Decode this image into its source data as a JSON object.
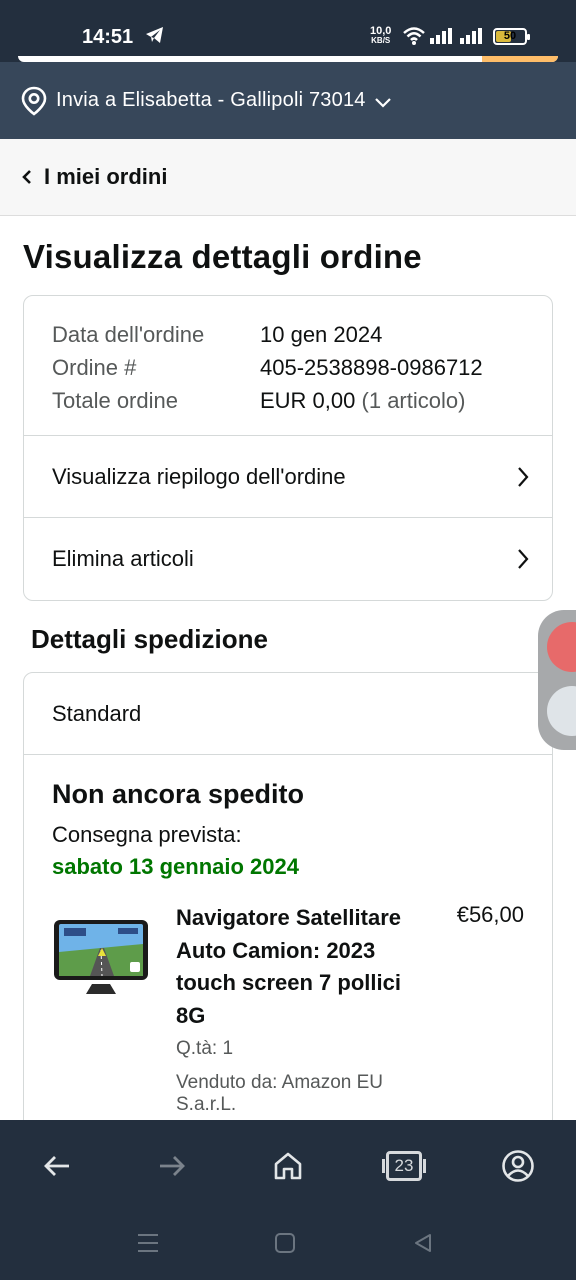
{
  "status_bar": {
    "time": "14:51",
    "net_speed_value": "10,0",
    "net_speed_unit": "KB/S",
    "battery": "50",
    "battery_level": 0.5
  },
  "deliver": {
    "text": "Invia a Elisabetta - Gallipoli 73014"
  },
  "nav": {
    "back_label": "I miei ordini"
  },
  "page": {
    "title": "Visualizza dettagli ordine"
  },
  "order": {
    "date_label": "Data dell'ordine",
    "date_value": "10 gen 2024",
    "number_label": "Ordine #",
    "number_value": "405-2538898-0986712",
    "total_label": "Totale ordine",
    "total_value": "EUR 0,00",
    "total_items": "(1 articolo)",
    "summary_link": "Visualizza riepilogo dell'ordine",
    "remove_link": "Elimina articoli"
  },
  "shipping": {
    "section_title": "Dettagli spedizione",
    "type": "Standard",
    "status": "Non ancora spedito",
    "eta_label": "Consegna prevista:",
    "eta_date": "sabato 13 gennaio 2024",
    "product": {
      "name": "Navigatore Satellitare Auto Camion: 2023 touch screen 7 pollici 8G",
      "price": "€56,00",
      "qty": "Q.tà: 1",
      "seller": "Venduto da: Amazon EU S.a.r.L."
    }
  },
  "browser_nav": {
    "tab_count": "23"
  },
  "colors": {
    "header_dark": "#232f3e",
    "deliver_bar": "#37475a",
    "eta_green": "#007600",
    "search_accent": "#febd69"
  },
  "icons": [
    "telegram-icon",
    "wifi-icon",
    "signal-icon",
    "battery-icon",
    "location-pin-icon",
    "chevron-down-icon",
    "chevron-left-icon",
    "chevron-right-icon",
    "back-arrow-icon",
    "forward-arrow-icon",
    "home-icon",
    "tabs-icon",
    "account-icon",
    "menu-icon",
    "square-icon",
    "triangle-back-icon"
  ]
}
